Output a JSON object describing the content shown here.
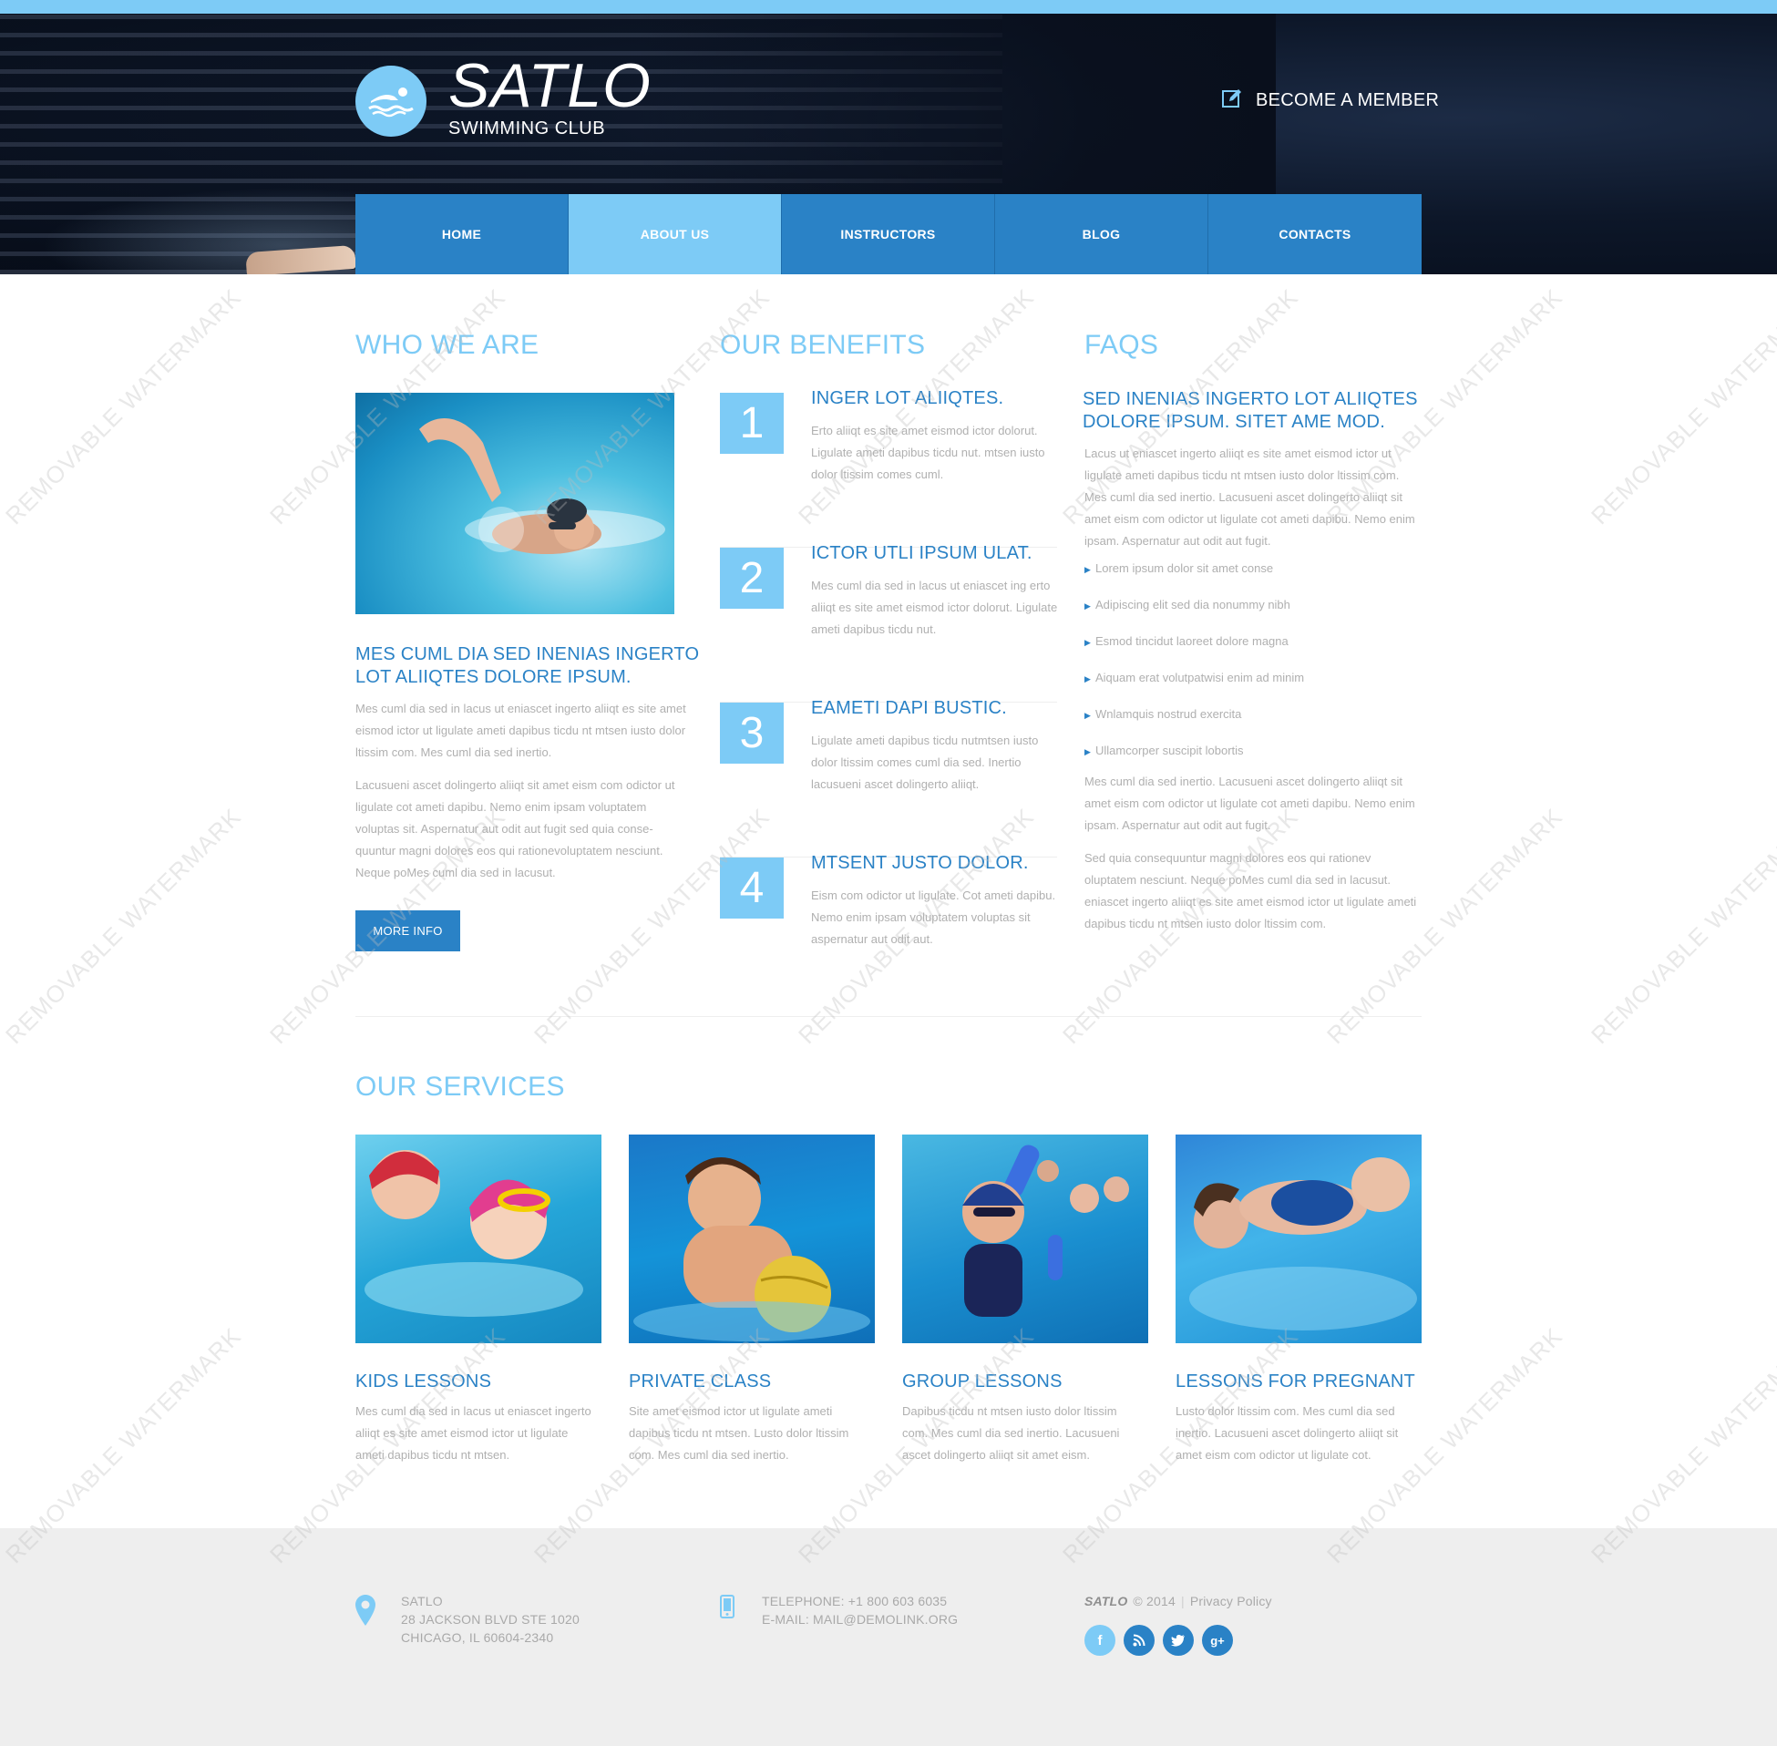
{
  "brand": {
    "name": "SATLO",
    "tagline": "SWIMMING CLUB",
    "accent": "#7dcbf6",
    "primary": "#2a82c6"
  },
  "header": {
    "member_link": "BECOME A MEMBER",
    "member_icon": "edit-icon"
  },
  "nav": {
    "items": [
      {
        "label": "HOME",
        "active": false
      },
      {
        "label": "ABOUT US",
        "active": true
      },
      {
        "label": "INSTRUCTORS",
        "active": false
      },
      {
        "label": "BLOG",
        "active": false
      },
      {
        "label": "CONTACTS",
        "active": false
      }
    ]
  },
  "who": {
    "heading": "WHO WE ARE",
    "title": "MES CUML DIA SED INENIAS INGERTO LOT ALIIQTES DOLORE IPSUM.",
    "p1": "Mes cuml dia sed in lacus ut eniascet ingerto aliiqt es site amet eismod ictor ut ligulate ameti dapibus ticdu nt mtsen iusto dolor ltissim com. Mes cuml dia sed inertio.",
    "p2": "Lacusueni ascet dolingerto aliiqt sit amet eism com odictor ut ligulate cot ameti dapibu. Nemo enim ipsam voluptatem voluptas sit. Aspernatur aut odit aut fugit sed quia conse-quuntur magni dolores eos qui rationevoluptatem nesciunt. Neque poMes cuml dia sed in lacusut.",
    "button": "MORE INFO"
  },
  "benefits": {
    "heading": "OUR BENEFITS",
    "items": [
      {
        "num": "1",
        "title": "INGER LOT ALIIQTES.",
        "text": "Erto aliiqt es site amet eismod ictor dolorut. Ligulate ameti dapibus ticdu nut. mtsen iusto dolor ltissim comes cuml."
      },
      {
        "num": "2",
        "title": "ICTOR UTLI IPSUM ULAT.",
        "text": "Mes cuml dia sed in lacus ut eniascet ing erto aliiqt es site amet eismod ictor dolorut. Ligulate ameti dapibus ticdu nut."
      },
      {
        "num": "3",
        "title": "EAMETI DAPI BUSTIC.",
        "text": "Ligulate ameti dapibus ticdu nutmtsen iusto dolor ltissim comes cuml dia sed. Inertio lacusueni ascet dolingerto aliiqt."
      },
      {
        "num": "4",
        "title": "MTSENT JUSTO DOLOR.",
        "text": "Eism com odictor ut ligulate. Cot ameti dapibu. Nemo enim ipsam voluptatem voluptas sit aspernatur aut odit aut."
      }
    ]
  },
  "faqs": {
    "heading": "FAQS",
    "title": "SED INENIAS INGERTO LOT ALIIQTES DOLORE IPSUM. SITET AME MOD.",
    "p1": "Lacus ut eniascet ingerto aliiqt es site amet eismod ictor ut ligulate ameti dapibus ticdu nt mtsen iusto dolor ltissim com. Mes cuml dia sed inertio. Lacusueni ascet dolingerto aliiqt sit amet eism com odictor ut ligulate cot ameti dapibu. Nemo enim ipsam. Aspernatur aut odit aut fugit.",
    "list": [
      "Lorem ipsum dolor sit amet conse",
      "Adipiscing elit sed dia nonummy nibh",
      "Esmod tincidut laoreet dolore magna",
      "Aiquam erat volutpatwisi enim ad minim",
      "Wnlamquis nostrud exercita",
      "Ullamcorper suscipit lobortis"
    ],
    "p2": "Mes cuml dia sed inertio. Lacusueni ascet dolingerto aliiqt sit amet eism com odictor ut ligulate cot ameti dapibu. Nemo enim ipsam. Aspernatur aut odit aut fugit.",
    "p3": "Sed quia consequuntur magni dolores eos qui rationev oluptatem nesciunt. Neque poMes cuml dia sed in lacusut. eniascet ingerto aliiqt es site amet eismod ictor ut ligulate ameti dapibus ticdu nt mtsen iusto dolor ltissim com."
  },
  "services": {
    "heading": "OUR SERVICES",
    "items": [
      {
        "title": "KIDS LESSONS",
        "text": "Mes cuml dia sed in lacus ut eniascet ingerto aliiqt es site amet eismod ictor ut ligulate ameti dapibus ticdu nt mtsen."
      },
      {
        "title": "PRIVATE CLASS",
        "text": "Site amet eismod ictor ut ligulate ameti dapibus ticdu nt mtsen. Lusto dolor ltissim com. Mes cuml dia sed inertio."
      },
      {
        "title": "GROUP LESSONS",
        "text": "Dapibus ticdu nt mtsen iusto dolor ltissim com. Mes cuml dia sed inertio. Lacusueni ascet dolingerto aliiqt sit amet eism."
      },
      {
        "title": "LESSONS FOR PREGNANT",
        "text": "Lusto dolor ltissim com. Mes cuml dia sed inertio. Lacusueni ascet dolingerto aliiqt sit amet eism com odictor ut ligulate cot."
      }
    ]
  },
  "footer": {
    "address_name": "SATLO",
    "address_line1": "28 JACKSON BLVD STE 1020",
    "address_line2": "CHICAGO, IL 60604-2340",
    "telephone": "TELEPHONE: +1 800 603 6035",
    "email": "E-MAIL: MAIL@DEMOLINK.ORG",
    "copyright_brand": "SATLO",
    "copyright_rest": "© 2014",
    "privacy": "Privacy Policy",
    "social": [
      {
        "name": "facebook-icon",
        "glyph": "f",
        "color": "#7dcbf6"
      },
      {
        "name": "rss-icon",
        "glyph": "rss",
        "color": "#2a82c6"
      },
      {
        "name": "twitter-icon",
        "glyph": "t",
        "color": "#2a82c6"
      },
      {
        "name": "google-plus-icon",
        "glyph": "g+",
        "color": "#2a82c6"
      }
    ]
  },
  "watermark": "REMOVABLE WATERMARK"
}
